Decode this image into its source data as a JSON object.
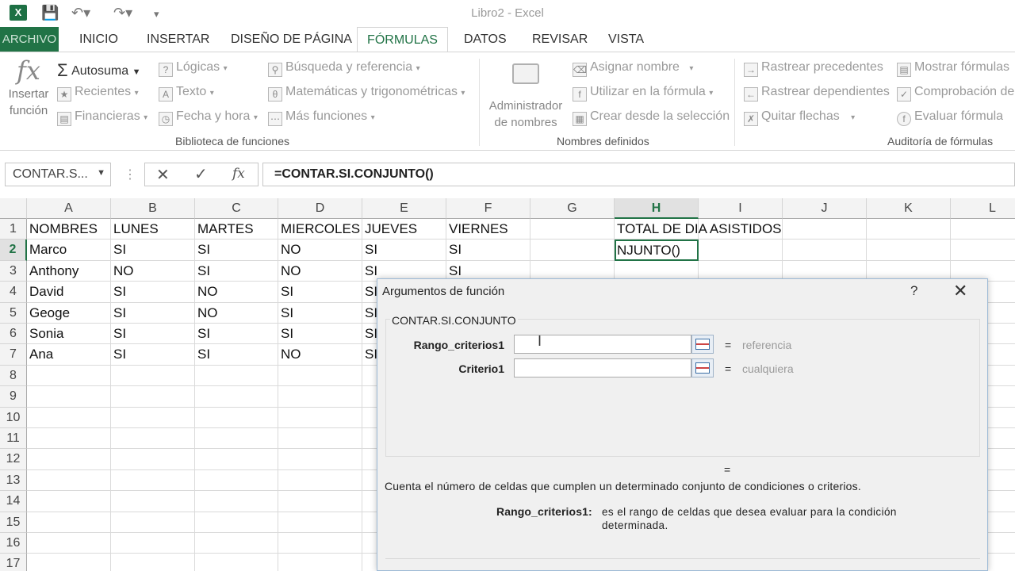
{
  "window": {
    "title": "Libro2 - Excel"
  },
  "tabs": [
    "ARCHIVO",
    "INICIO",
    "INSERTAR",
    "DISEÑO DE PÁGINA",
    "FÓRMULAS",
    "DATOS",
    "REVISAR",
    "VISTA"
  ],
  "ribbon": {
    "insert_function": {
      "line1": "Insertar",
      "line2": "función",
      "icon": "fx"
    },
    "autosum": "Autosuma",
    "recent": "Recientes",
    "financial": "Financieras",
    "logical": "Lógicas",
    "text": "Texto",
    "datetime": "Fecha y hora",
    "lookup": "Búsqueda y referencia",
    "math": "Matemáticas y trigonométricas",
    "more": "Más funciones",
    "group_library": "Biblioteca de funciones",
    "name_manager": {
      "line1": "Administrador",
      "line2": "de nombres"
    },
    "define_name": "Asignar nombre",
    "use_in_formula": "Utilizar en la fórmula",
    "create_from_selection": "Crear desde la selección",
    "group_names": "Nombres definidos",
    "trace_precedents": "Rastrear precedentes",
    "trace_dependents": "Rastrear dependientes",
    "remove_arrows": "Quitar flechas",
    "show_formulas": "Mostrar fórmulas",
    "error_checking": "Comprobación de",
    "evaluate_formula": "Evaluar fórmula",
    "group_auditing": "Auditoría de fórmulas"
  },
  "formula_bar": {
    "name_box": "CONTAR.S...",
    "formula": "=CONTAR.SI.CONJUNTO()"
  },
  "columns": [
    "A",
    "B",
    "C",
    "D",
    "E",
    "F",
    "G",
    "H",
    "I",
    "J",
    "K",
    "L"
  ],
  "rows": [
    "1",
    "2",
    "3",
    "4",
    "5",
    "6",
    "7",
    "8",
    "9",
    "10",
    "11",
    "12",
    "13",
    "14",
    "15",
    "16",
    "17"
  ],
  "cells": {
    "header": [
      "NOMBRES",
      "LUNES",
      "MARTES",
      "MIERCOLES",
      "JUEVES",
      "VIERNES"
    ],
    "total_header": "TOTAL DE DIA ASISTIDOS",
    "active": "NJUNTO()",
    "data": [
      [
        "Marco",
        "SI",
        "SI",
        "NO",
        "SI",
        "SI"
      ],
      [
        "Anthony",
        "NO",
        "SI",
        "NO",
        "SI",
        "SI"
      ],
      [
        "David",
        "SI",
        "NO",
        "SI",
        "SI",
        ""
      ],
      [
        "Geoge",
        "SI",
        "NO",
        "SI",
        "SI",
        ""
      ],
      [
        "Sonia",
        "SI",
        "SI",
        "SI",
        "SI",
        ""
      ],
      [
        "Ana",
        "SI",
        "SI",
        "NO",
        "SI",
        ""
      ]
    ]
  },
  "dialog": {
    "title": "Argumentos de función",
    "help": "?",
    "close": "✕",
    "function_name": "CONTAR.SI.CONJUNTO",
    "args": [
      {
        "label": "Rango_criterios1",
        "value": "",
        "result": "referencia"
      },
      {
        "label": "Criterio1",
        "value": "",
        "result": "cualquiera"
      }
    ],
    "equals": "=",
    "description": "Cuenta el número de celdas que cumplen un determinado conjunto de condiciones o criterios.",
    "arg_help_name": "Rango_criterios1:",
    "arg_help_text": "es el rango de celdas que desea evaluar para la condición determinada."
  },
  "colors": {
    "excel_green": "#217346",
    "dialog_bg": "#f0f0f0"
  }
}
